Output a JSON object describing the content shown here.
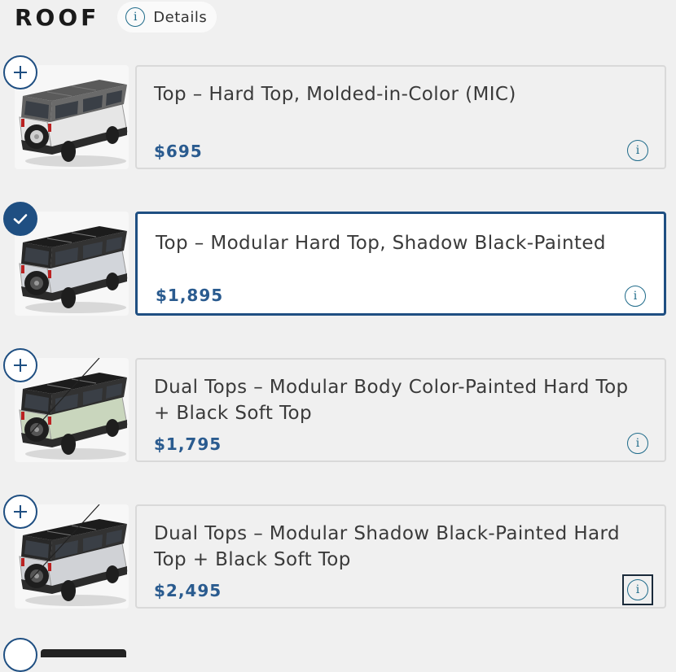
{
  "section": {
    "title": "ROOF",
    "details_label": "Details",
    "info_glyph": "i"
  },
  "options": [
    {
      "title": "Top – Hard Top, Molded-in-Color (MIC)",
      "price": "$695",
      "selected": false,
      "vehicle": "white Bronco with gray molded-in-color hard top",
      "body_color": "#e6e6e6",
      "top_color": "#5a5a5a"
    },
    {
      "title": "Top – Modular Hard Top, Shadow Black-Painted",
      "price": "$1,895",
      "selected": true,
      "vehicle": "silver Bronco with black hard top",
      "body_color": "#d2d5da",
      "top_color": "#1c1c1c"
    },
    {
      "title": "Dual Tops – Modular Body Color-Painted Hard Top + Black Soft Top",
      "price": "$1,795",
      "selected": false,
      "vehicle": "sage green Bronco with dual tops",
      "body_color": "#c9d6bd",
      "top_color": "#1c1c1c"
    },
    {
      "title": "Dual Tops – Modular Shadow Black-Painted Hard Top + Black Soft Top",
      "price": "$2,495",
      "selected": false,
      "vehicle": "silver Bronco with dual black tops",
      "body_color": "#d0d2d6",
      "top_color": "#1c1c1c"
    }
  ],
  "colors": {
    "accent": "#1f4f82",
    "price": "#2a5b8f",
    "info": "#1f6b8a",
    "background": "#f0f0f0",
    "card_border": "#d9d9d9"
  },
  "icons": {
    "add": "plus-icon",
    "selected": "checkmark-icon",
    "info": "info-icon"
  }
}
